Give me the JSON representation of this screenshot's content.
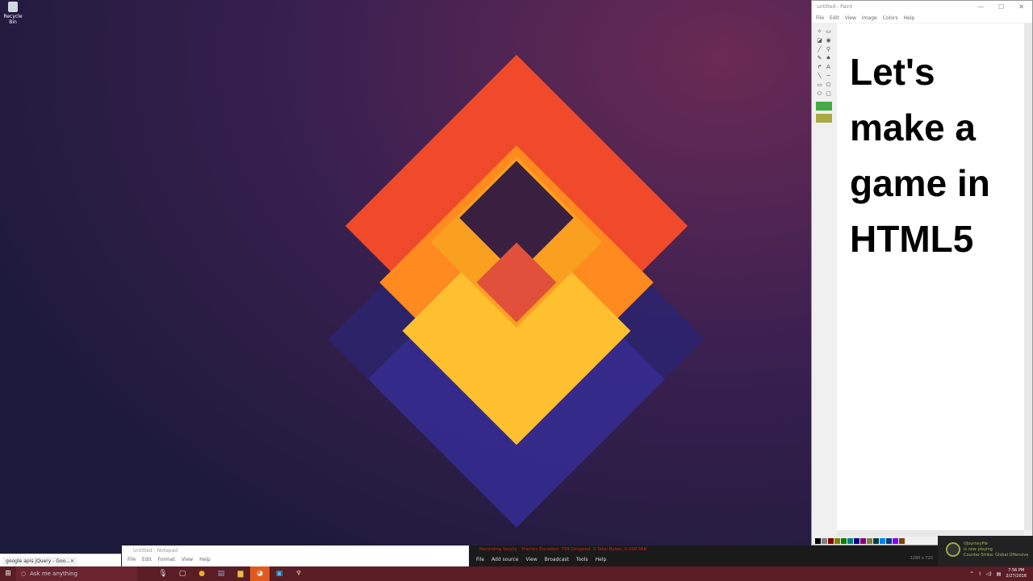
{
  "desktop": {
    "recycle_bin_label": "Recycle Bin"
  },
  "paint": {
    "title": "untitled - Paint",
    "window_controls": [
      "—",
      "☐",
      "✕"
    ],
    "menu": [
      "File",
      "Edit",
      "View",
      "Image",
      "Colors",
      "Help"
    ],
    "canvas_text": [
      "Let's",
      "make a",
      "game in",
      "HTML5"
    ],
    "palette": [
      "#000000",
      "#808080",
      "#800000",
      "#808000",
      "#008000",
      "#008080",
      "#000080",
      "#800080",
      "#808040",
      "#004040",
      "#0080ff",
      "#004080",
      "#8000ff",
      "#804000"
    ]
  },
  "chrome": {
    "tab_title": "google apis jQuery - Goo...",
    "tab_close": "×"
  },
  "notepad": {
    "title": "Untitled - Notepad",
    "menu": [
      "File",
      "Edit",
      "Format",
      "View",
      "Help"
    ]
  },
  "obs": {
    "status": "Recording locally - Frames Encoded: 799 Dropped: 0 Total Bytes: 0.000 MiB",
    "menu": [
      "File",
      "Add source",
      "View",
      "Broadcast",
      "Tools",
      "Help"
    ],
    "resolution": "1280 x 720"
  },
  "notification": {
    "user": "UJourneyPie",
    "line2": "is now playing",
    "game": "Counter-Strike: Global Offensive"
  },
  "taskbar": {
    "search_placeholder": "Ask me anything",
    "time": "7:56 PM",
    "date": "2/27/2016"
  }
}
